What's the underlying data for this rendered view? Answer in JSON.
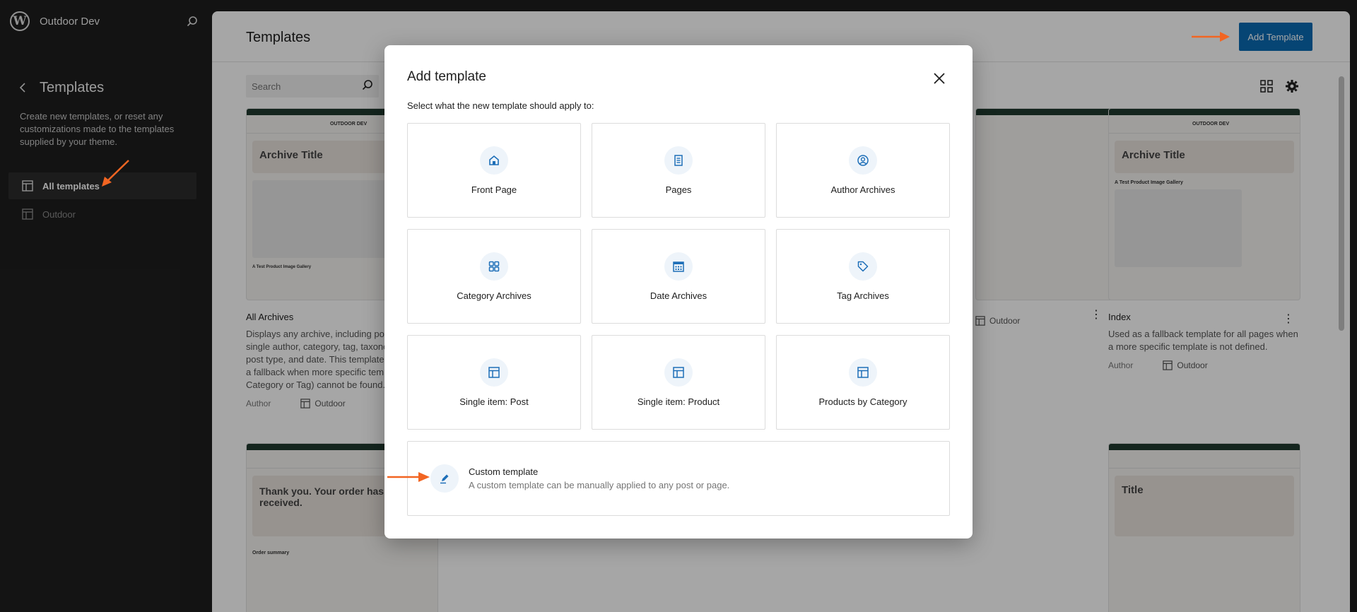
{
  "app": {
    "site_name": "Outdoor Dev"
  },
  "sidebar": {
    "title": "Templates",
    "description": "Create new templates, or reset any customizations made to the templates supplied by your theme.",
    "items": [
      {
        "label": "All templates"
      },
      {
        "label": "Outdoor"
      }
    ]
  },
  "main": {
    "title": "Templates",
    "add_button": "Add Template",
    "search_placeholder": "Search",
    "cards": [
      {
        "title": "All Archives",
        "thumb_heading": "Archive Title",
        "thumb_brand": "OUTDOOR DEV",
        "thumb_caption": "A Test Product Image Gallery",
        "description": "Displays any archive, including posts by a single author, category, tag, taxonomy, custom post type, and date. This template will serve as a fallback when more specific templates (e.g. Category or Tag) cannot be found.",
        "author_label": "Author",
        "author": "Outdoor"
      },
      {
        "title": "Index",
        "thumb_heading": "Archive Title",
        "thumb_brand": "OUTDOOR DEV",
        "thumb_caption": "A Test Product Image Gallery",
        "description": "Used as a fallback template for all pages when a more specific template is not defined.",
        "author_label": "Author",
        "author": "Outdoor"
      },
      {
        "author": "Outdoor"
      },
      {
        "thumb_heading": "Thank you. Your order has been received.",
        "thumb_caption": "Order summary"
      },
      {
        "thumb_heading": "Title"
      }
    ]
  },
  "modal": {
    "title": "Add template",
    "subtitle": "Select what the new template should apply to:",
    "options": [
      {
        "label": "Front Page",
        "icon": "home-icon"
      },
      {
        "label": "Pages",
        "icon": "page-icon"
      },
      {
        "label": "Author Archives",
        "icon": "author-icon"
      },
      {
        "label": "Category Archives",
        "icon": "category-icon"
      },
      {
        "label": "Date Archives",
        "icon": "calendar-icon"
      },
      {
        "label": "Tag Archives",
        "icon": "tag-icon"
      },
      {
        "label": "Single item: Post",
        "icon": "layout-icon"
      },
      {
        "label": "Single item: Product",
        "icon": "layout-icon"
      },
      {
        "label": "Products by Category",
        "icon": "layout-icon"
      }
    ],
    "custom": {
      "title": "Custom template",
      "description": "A custom template can be manually applied to any post or page.",
      "icon": "pencil-icon"
    }
  },
  "colors": {
    "accent": "#0a6ab3",
    "annotation_arrow": "#f26522",
    "icon_blue": "#1e6fb8"
  }
}
